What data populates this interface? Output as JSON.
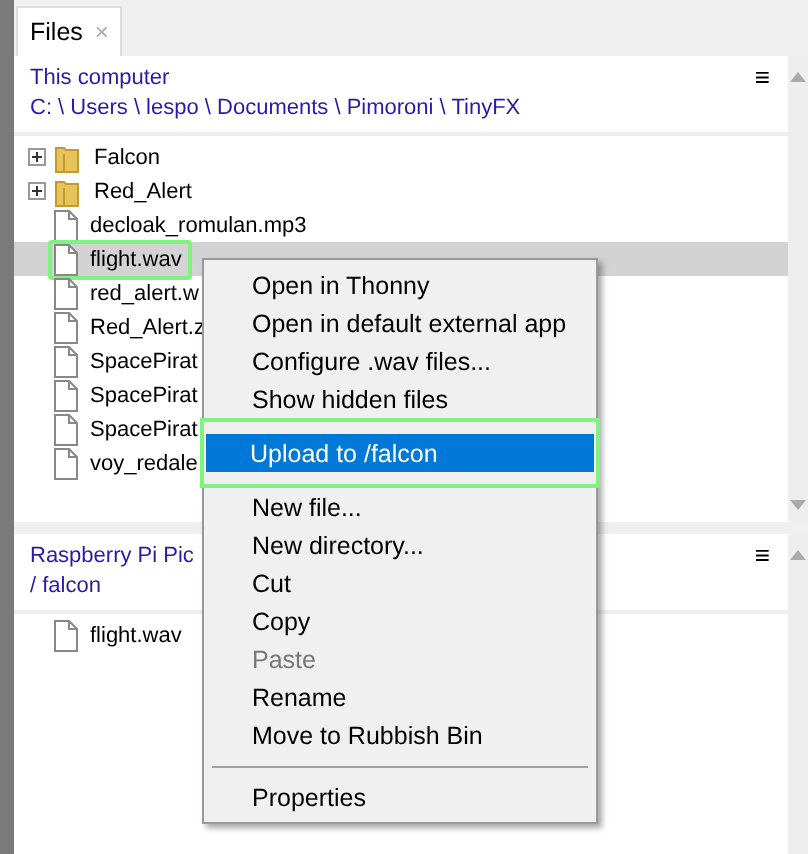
{
  "tabs": [
    {
      "label": "Files",
      "selected": true,
      "close": "×"
    }
  ],
  "panels": [
    {
      "title": "This computer",
      "path": "C: \\ Users \\ lespo \\ Documents \\ Pimoroni \\ TinyFX",
      "menu": "≡",
      "items": [
        {
          "kind": "folder",
          "name": "Falcon",
          "expanded": false,
          "selected": false,
          "outlined": false
        },
        {
          "kind": "folder",
          "name": "Red_Alert",
          "expanded": false,
          "selected": false,
          "outlined": false
        },
        {
          "kind": "file",
          "name": "decloak_romulan.mp3",
          "selected": false,
          "outlined": false
        },
        {
          "kind": "file",
          "name": "flight.wav",
          "selected": true,
          "outlined": true
        },
        {
          "kind": "file",
          "name": "red_alert.w",
          "selected": false,
          "outlined": false
        },
        {
          "kind": "file",
          "name": "Red_Alert.z",
          "selected": false,
          "outlined": false
        },
        {
          "kind": "file",
          "name": "SpacePirat",
          "selected": false,
          "outlined": false
        },
        {
          "kind": "file",
          "name": "SpacePirat",
          "selected": false,
          "outlined": false
        },
        {
          "kind": "file",
          "name": "SpacePirat",
          "selected": false,
          "outlined": false
        },
        {
          "kind": "file",
          "name": "voy_redale",
          "selected": false,
          "outlined": false
        }
      ]
    },
    {
      "title": "Raspberry Pi Pic",
      "path": "/ falcon",
      "menu": "≡",
      "items": [
        {
          "kind": "file",
          "name": "flight.wav",
          "selected": false,
          "outlined": false
        }
      ]
    }
  ],
  "context_menu": {
    "items": [
      {
        "kind": "item",
        "label": "Open in Thonny",
        "selected": false,
        "disabled": false,
        "outlined": false
      },
      {
        "kind": "item",
        "label": "Open in default external app",
        "selected": false,
        "disabled": false,
        "outlined": false
      },
      {
        "kind": "item",
        "label": "Configure .wav files...",
        "selected": false,
        "disabled": false,
        "outlined": false
      },
      {
        "kind": "item",
        "label": "Show hidden files",
        "selected": false,
        "disabled": false,
        "outlined": false
      },
      {
        "kind": "separator"
      },
      {
        "kind": "item",
        "label": "Upload to /falcon",
        "selected": true,
        "disabled": false,
        "outlined": true
      },
      {
        "kind": "item",
        "label": "New file...",
        "selected": false,
        "disabled": false,
        "outlined": false
      },
      {
        "kind": "item",
        "label": "New directory...",
        "selected": false,
        "disabled": false,
        "outlined": false
      },
      {
        "kind": "item",
        "label": "Cut",
        "selected": false,
        "disabled": false,
        "outlined": false
      },
      {
        "kind": "item",
        "label": "Copy",
        "selected": false,
        "disabled": false,
        "outlined": false
      },
      {
        "kind": "item",
        "label": "Paste",
        "selected": false,
        "disabled": true,
        "outlined": false
      },
      {
        "kind": "item",
        "label": "Rename",
        "selected": false,
        "disabled": false,
        "outlined": false
      },
      {
        "kind": "item",
        "label": "Move to Rubbish Bin",
        "selected": false,
        "disabled": false,
        "outlined": false
      },
      {
        "kind": "separator"
      },
      {
        "kind": "item",
        "label": "Properties",
        "selected": false,
        "disabled": false,
        "outlined": false
      }
    ]
  }
}
